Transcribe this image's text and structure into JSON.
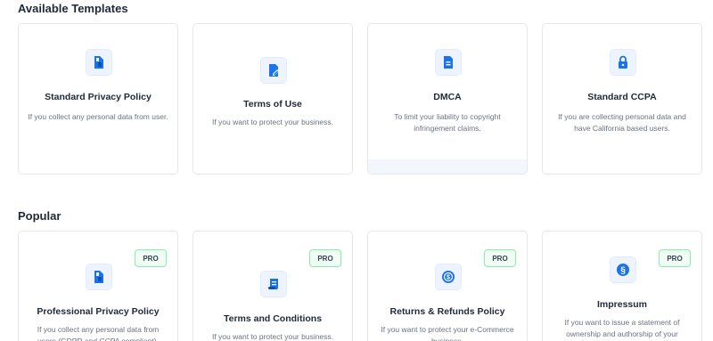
{
  "sections": {
    "available_title": "Available Templates",
    "popular_title": "Popular"
  },
  "available": [
    {
      "title": "Standard Privacy Policy",
      "desc": "If you collect any personal data from user.",
      "icon": "privacy-doc-icon"
    },
    {
      "title": "Terms of Use",
      "desc": "If you want to protect your business.",
      "icon": "document-pen-icon"
    },
    {
      "title": "DMCA",
      "desc": "To limit your liability to copyright infringement claims.",
      "icon": "document-lines-icon"
    },
    {
      "title": "Standard CCPA",
      "desc": "If you are collecting personal data and have California based users.",
      "icon": "lock-icon"
    }
  ],
  "popular": [
    {
      "title": "Professional Privacy Policy",
      "desc": "If you collect any personal data from users (GDPR and CCPA compliant).",
      "badge": "PRO",
      "icon": "privacy-doc-icon"
    },
    {
      "title": "Terms and Conditions",
      "desc": "If you want to protect your business.",
      "badge": "PRO",
      "icon": "scroll-icon"
    },
    {
      "title": "Returns & Refunds Policy",
      "desc": "If you want to protect your e-Commerce business.",
      "badge": "PRO",
      "icon": "refund-icon"
    },
    {
      "title": "Impressum",
      "desc": "If you want to issue a statement of ownership and authorship of your website.",
      "badge": "PRO",
      "icon": "section-sign-icon"
    }
  ],
  "colors": {
    "accent": "#1a73e8",
    "icon_bg": "#eef4ff",
    "pro_border": "#86efac",
    "pro_bg": "#f0fdf4"
  }
}
